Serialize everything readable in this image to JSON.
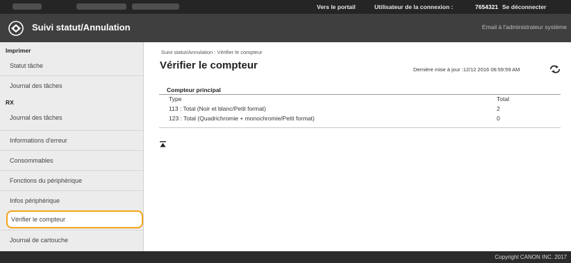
{
  "topbar": {
    "portal_link": "Vers le portail",
    "user_label": "Utilisateur de la connexion :",
    "user_id": "7654321",
    "logout": "Se déconnecter"
  },
  "header": {
    "title": "Suivi statut/Annulation",
    "email_admin": "Email à l'administrateur système"
  },
  "sidebar": {
    "sections": [
      {
        "label": "Imprimer",
        "items": [
          "Statut tâche",
          "Journal des tâches"
        ]
      },
      {
        "label": "RX",
        "items": [
          "Journal des tâches"
        ]
      }
    ],
    "other_items": [
      "Informations d'erreur",
      "Consommables",
      "Fonctions du périphérique",
      "Infos périphérique",
      "Vérifier le compteur",
      "Journal de cartouche"
    ],
    "selected": "Vérifier le compteur"
  },
  "main": {
    "breadcrumb": "Suivi statut/Annulation : Vérifier le compteur",
    "page_title": "Vérifier le compteur",
    "last_update": "Dernière mise à jour :12/12 2016 06:59:59 AM",
    "counter": {
      "heading": "Compteur principal",
      "columns": [
        "Type",
        "Total"
      ],
      "rows": [
        {
          "type": "113 : Total (Noir et blanc/Petit format)",
          "total": "2"
        },
        {
          "type": "123 : Total (Quadrichromie + monochromie/Petit format)",
          "total": "0"
        }
      ]
    }
  },
  "footer": {
    "copyright": "Copyright CANON INC. 2017"
  },
  "colors": {
    "topbar": "#252525",
    "titlebar": "#3f3f3f",
    "sidebar_bg": "#ececec",
    "selection_outline": "#f3a31b",
    "footer": "#2b2b2b"
  },
  "icons": [
    "app-logo-icon",
    "refresh-icon",
    "scroll-top-icon"
  ]
}
